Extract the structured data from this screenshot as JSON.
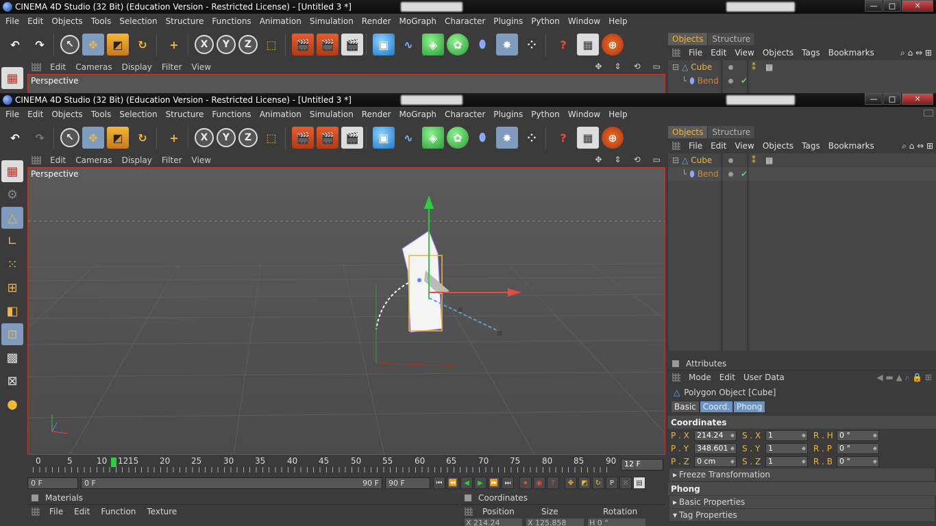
{
  "window": {
    "title": "CINEMA 4D Studio (32 Bit) (Education Version - Restricted License) - [Untitled 3 *]",
    "controls": {
      "minimize": "—",
      "maximize": "□",
      "close": "✕"
    }
  },
  "menu": [
    "File",
    "Edit",
    "Objects",
    "Tools",
    "Selection",
    "Structure",
    "Functions",
    "Animation",
    "Simulation",
    "Render",
    "MoGraph",
    "Character",
    "Plugins",
    "Python",
    "Window",
    "Help"
  ],
  "toolbar": {
    "icons": [
      "undo-icon",
      "redo-icon",
      "live-selection-icon",
      "move-icon",
      "scale-icon",
      "rotate-icon",
      "create-point-icon",
      "x-axis-lock-icon",
      "y-axis-lock-icon",
      "z-axis-lock-icon",
      "coordinate-system-icon",
      "render-view-icon",
      "render-picture-viewer-icon",
      "render-settings-icon",
      "cube-icon",
      "spline-pen-icon",
      "subdivision-surface-icon",
      "cloner-icon",
      "deformer-icon",
      "scene-icon",
      "particle-icon",
      "help-icon",
      "timeline-icon",
      "web-icon"
    ],
    "x_label": "X",
    "y_label": "Y",
    "z_label": "Z"
  },
  "viewport_menu": [
    "Edit",
    "Cameras",
    "Display",
    "Filter",
    "View"
  ],
  "viewport": {
    "label": "Perspective"
  },
  "left_tools": [
    "model-mode-icon",
    "texture-mode-icon",
    "object-mode-icon",
    "axis-mode-icon",
    "points-mode-icon",
    "edges-mode-icon",
    "polygons-mode-icon",
    "uv-mode-icon",
    "checker-icon",
    "workplane-icon",
    "sculpt-icon"
  ],
  "object_manager": {
    "tabs": [
      "Objects",
      "Structure"
    ],
    "menu": [
      "File",
      "Edit",
      "View",
      "Objects",
      "Tags",
      "Bookmarks"
    ],
    "objects": [
      {
        "name": "Cube",
        "type_icon": "polygon-icon"
      },
      {
        "name": "Bend",
        "type_icon": "bend-deformer-icon",
        "check": "✔"
      }
    ]
  },
  "attributes": {
    "title": "Attributes",
    "menu": [
      "Mode",
      "Edit",
      "User Data"
    ],
    "object": "Polygon Object [Cube]",
    "tabs": [
      "Basic",
      "Coord.",
      "Phong"
    ],
    "active_tab": "Coord.",
    "section": "Coordinates",
    "rows": [
      {
        "p_label": "P . X",
        "p_val": "214.24 cm",
        "s_label": "S . X",
        "s_val": "1",
        "r_label": "R . H",
        "r_val": "0 °"
      },
      {
        "p_label": "P . Y",
        "p_val": "348.601 cı",
        "s_label": "S . Y",
        "s_val": "1",
        "r_label": "R . P",
        "r_val": "0 °"
      },
      {
        "p_label": "P . Z",
        "p_val": "0 cm",
        "s_label": "S . Z",
        "s_val": "1",
        "r_label": "R . B",
        "r_val": "0 °"
      }
    ],
    "freeze": "Freeze Transformation",
    "phong_section": "Phong",
    "basic_props": "Basic Properties",
    "tag_props": "Tag Properties"
  },
  "timeline": {
    "ticks": [
      "0",
      "5",
      "10",
      "15",
      "20",
      "25",
      "30",
      "35",
      "40",
      "45",
      "50",
      "55",
      "60",
      "65",
      "70",
      "75",
      "80",
      "85",
      "90"
    ],
    "current": "12",
    "current_field": "12 F",
    "start": "0 F",
    "range_start": "0 F",
    "range_end": "90 F",
    "end": "90 F"
  },
  "materials": {
    "title": "Materials",
    "menu": [
      "File",
      "Edit",
      "Function",
      "Texture"
    ]
  },
  "coordinates": {
    "title": "Coordinates",
    "cols": [
      "Position",
      "Size",
      "Rotation"
    ],
    "partial": [
      "X 214.24",
      "X 125.858",
      "H 0 °"
    ]
  }
}
